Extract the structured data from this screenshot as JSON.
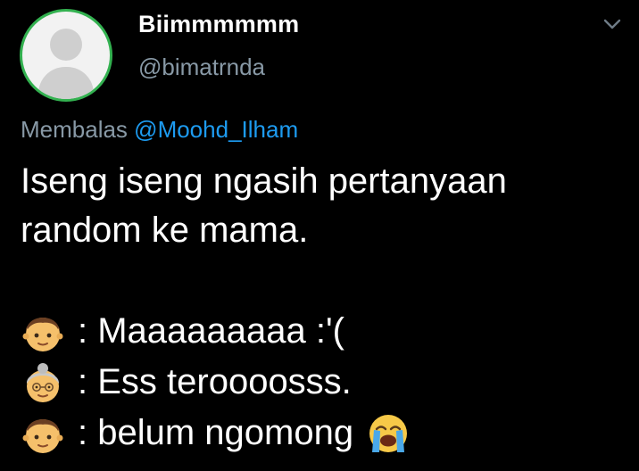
{
  "user": {
    "display_name": "Biimmmmmm",
    "handle": "@bimatrnda"
  },
  "reply": {
    "prefix": "Membalas",
    "mention": "@Moohd_Ilham"
  },
  "tweet": {
    "line1": "Iseng iseng ngasih pertanyaan",
    "line2": "random ke mama.",
    "dialog": [
      {
        "speaker_icon": "boy-emoji-icon",
        "text": ": Maaaaaaaaa :'("
      },
      {
        "speaker_icon": "old-woman-emoji-icon",
        "text": ": Ess teroooosss."
      },
      {
        "speaker_icon": "boy-emoji-icon",
        "text": ": belum ngomong",
        "trailing_icon": "loudly-crying-face-emoji-icon"
      }
    ]
  },
  "icons": {
    "menu": "chevron-down-icon",
    "avatar": "default-avatar-icon"
  },
  "colors": {
    "background": "#000000",
    "secondary_text": "#8899a6",
    "link": "#1d9bf0",
    "avatar_ring": "#33b150"
  }
}
